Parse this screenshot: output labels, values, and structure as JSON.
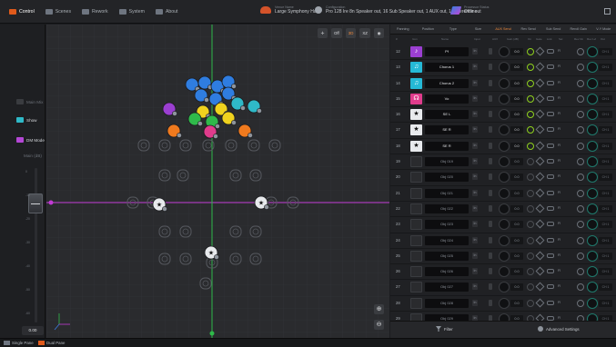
{
  "nav": {
    "items": [
      {
        "label": "Control",
        "active": true
      },
      {
        "label": "Scenes",
        "active": false
      },
      {
        "label": "Rework",
        "active": false
      },
      {
        "label": "System",
        "active": false
      },
      {
        "label": "About",
        "active": false
      }
    ]
  },
  "venue": {
    "label": "Venue Name",
    "value": "Large Symphony Hall"
  },
  "preset": {
    "label": "Configuration",
    "value": "Pro 128 Ire 8n Speaker out, 16 Sub Speaker out, 1 AUX out, 1 Reference out"
  },
  "processor": {
    "label": "Processor Status",
    "value": "Offline"
  },
  "stage": {
    "tools": {
      "mode": "Off",
      "orbit": "3D",
      "view": "XZ"
    },
    "accent_color": "#c23bd4",
    "axis_color": "#2fb94a"
  },
  "left": {
    "buttons": [
      {
        "label": "Main Mix",
        "color": "#4b4e53"
      },
      {
        "label": "Show",
        "color": "#2fb9c8"
      },
      {
        "label": "DM Mode",
        "color": "#b447d6"
      }
    ],
    "fader_label": "Main (dB)",
    "ticks": [
      "0",
      "-10",
      "-20",
      "-30",
      "-40",
      "-50",
      "-60"
    ],
    "value": "0.00"
  },
  "table": {
    "tabs": [
      "Panning",
      "Position",
      "Type",
      "Size",
      "AUX Send",
      "Rev Send",
      "Sub Send",
      "Reroll Gain",
      "V-Y Mode"
    ],
    "active_tab": "AUX Send",
    "columns": [
      "#",
      "Icon",
      "Name",
      "Input",
      "AUX",
      "Gain (dB)",
      "On",
      "Gate",
      "Link",
      "Sel",
      "Rev On",
      "Rev Lvl",
      "Out"
    ],
    "rows": [
      {
        "num": "12",
        "name": "Pf",
        "icon_color": "#9b3fd1",
        "glyph": "♪",
        "db": "0.0",
        "on": true
      },
      {
        "num": "13",
        "name": "Chorus 1",
        "icon_color": "#25b9d6",
        "glyph": "♫",
        "db": "0.0",
        "on": true
      },
      {
        "num": "14",
        "name": "Chorus 2",
        "icon_color": "#25b9d6",
        "glyph": "♫",
        "db": "0.0",
        "on": true
      },
      {
        "num": "15",
        "name": "Vo",
        "icon_color": "#e03c8c",
        "glyph": "☊",
        "db": "0.0",
        "on": true
      },
      {
        "num": "16",
        "name": "SE L",
        "icon_color": "#e8eaed",
        "glyph": "★",
        "db": "0.0",
        "on": true
      },
      {
        "num": "17",
        "name": "SE R",
        "icon_color": "#e8eaed",
        "glyph": "★",
        "db": "0.0",
        "on": true
      },
      {
        "num": "18",
        "name": "SE R",
        "icon_color": "#e8eaed",
        "glyph": "★",
        "db": "0.0",
        "on": true
      },
      {
        "num": "19",
        "name": "Obj 019",
        "icon_color": "#2a2b2e",
        "glyph": "",
        "db": "0.0",
        "on": false
      },
      {
        "num": "20",
        "name": "Obj 020",
        "icon_color": "#2a2b2e",
        "glyph": "",
        "db": "0.0",
        "on": false
      },
      {
        "num": "21",
        "name": "Obj 021",
        "icon_color": "#2a2b2e",
        "glyph": "",
        "db": "0.0",
        "on": false
      },
      {
        "num": "22",
        "name": "Obj 022",
        "icon_color": "#2a2b2e",
        "glyph": "",
        "db": "0.0",
        "on": false
      },
      {
        "num": "23",
        "name": "Obj 023",
        "icon_color": "#2a2b2e",
        "glyph": "",
        "db": "0.0",
        "on": false
      },
      {
        "num": "24",
        "name": "Obj 024",
        "icon_color": "#2a2b2e",
        "glyph": "",
        "db": "0.0",
        "on": false
      },
      {
        "num": "25",
        "name": "Obj 025",
        "icon_color": "#2a2b2e",
        "glyph": "",
        "db": "0.0",
        "on": false
      },
      {
        "num": "26",
        "name": "Obj 026",
        "icon_color": "#2a2b2e",
        "glyph": "",
        "db": "0.0",
        "on": false
      },
      {
        "num": "27",
        "name": "Obj 027",
        "icon_color": "#2a2b2e",
        "glyph": "",
        "db": "0.0",
        "on": false
      },
      {
        "num": "28",
        "name": "Obj 028",
        "icon_color": "#2a2b2e",
        "glyph": "",
        "db": "0.0",
        "on": false
      },
      {
        "num": "29",
        "name": "Obj 029",
        "icon_color": "#2a2b2e",
        "glyph": "",
        "db": "0.0",
        "on": false
      },
      {
        "num": "30",
        "name": "Obj 030",
        "icon_color": "#2a2b2e",
        "glyph": "",
        "db": "0.0",
        "on": false
      }
    ],
    "row_labels": {
      "input": "In",
      "sel": "Fl",
      "out": "CH 1"
    },
    "footer": {
      "filter": "Filter",
      "advanced": "Advanced Settings"
    }
  },
  "bottom": {
    "items": [
      {
        "label": "Single Pane",
        "active": false
      },
      {
        "label": "Dual Pane",
        "active": true
      }
    ]
  }
}
